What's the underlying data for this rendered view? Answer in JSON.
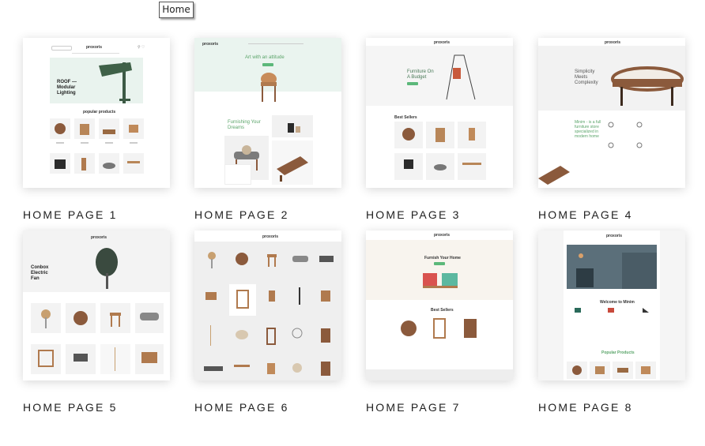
{
  "tooltip": {
    "text": "Home"
  },
  "homepages": [
    {
      "label": "HOME PAGE 1"
    },
    {
      "label": "HOME PAGE 2"
    },
    {
      "label": "HOME PAGE 3"
    },
    {
      "label": "HOME PAGE 4"
    },
    {
      "label": "HOME PAGE 5"
    },
    {
      "label": "HOME PAGE 6"
    },
    {
      "label": "HOME PAGE 7"
    },
    {
      "label": "HOME PAGE 8"
    }
  ],
  "previews": {
    "p1": {
      "logo": "proxoris",
      "hero": "ROOF — Modular Lighting",
      "section": "popular products"
    },
    "p2": {
      "logo": "proxoris",
      "hero": "Art with an attitude",
      "promo": "Furnishing Your Dreams"
    },
    "p3": {
      "logo": "proxoris",
      "hero": "Furniture On A Budget",
      "section": "Best Sellers"
    },
    "p4": {
      "logo": "proxoris",
      "hero": "Simplicity Meets Complexity",
      "about": "Minim - is a full furniture store specialized in modern home"
    },
    "p5": {
      "logo": "proxoris",
      "hero": "Conbox Electric Fan"
    },
    "p6": {
      "logo": "proxoris"
    },
    "p7": {
      "logo": "proxoris",
      "hero": "Furnish Your Home",
      "section": "Best Sellers"
    },
    "p8": {
      "logo": "proxoris",
      "welcome": "Welcome to Minim",
      "section": "Popular Products"
    }
  },
  "colors": {
    "accent": "#5cb87a",
    "wood": "#8b5a3c",
    "heroMint": "#e9f3ee"
  }
}
